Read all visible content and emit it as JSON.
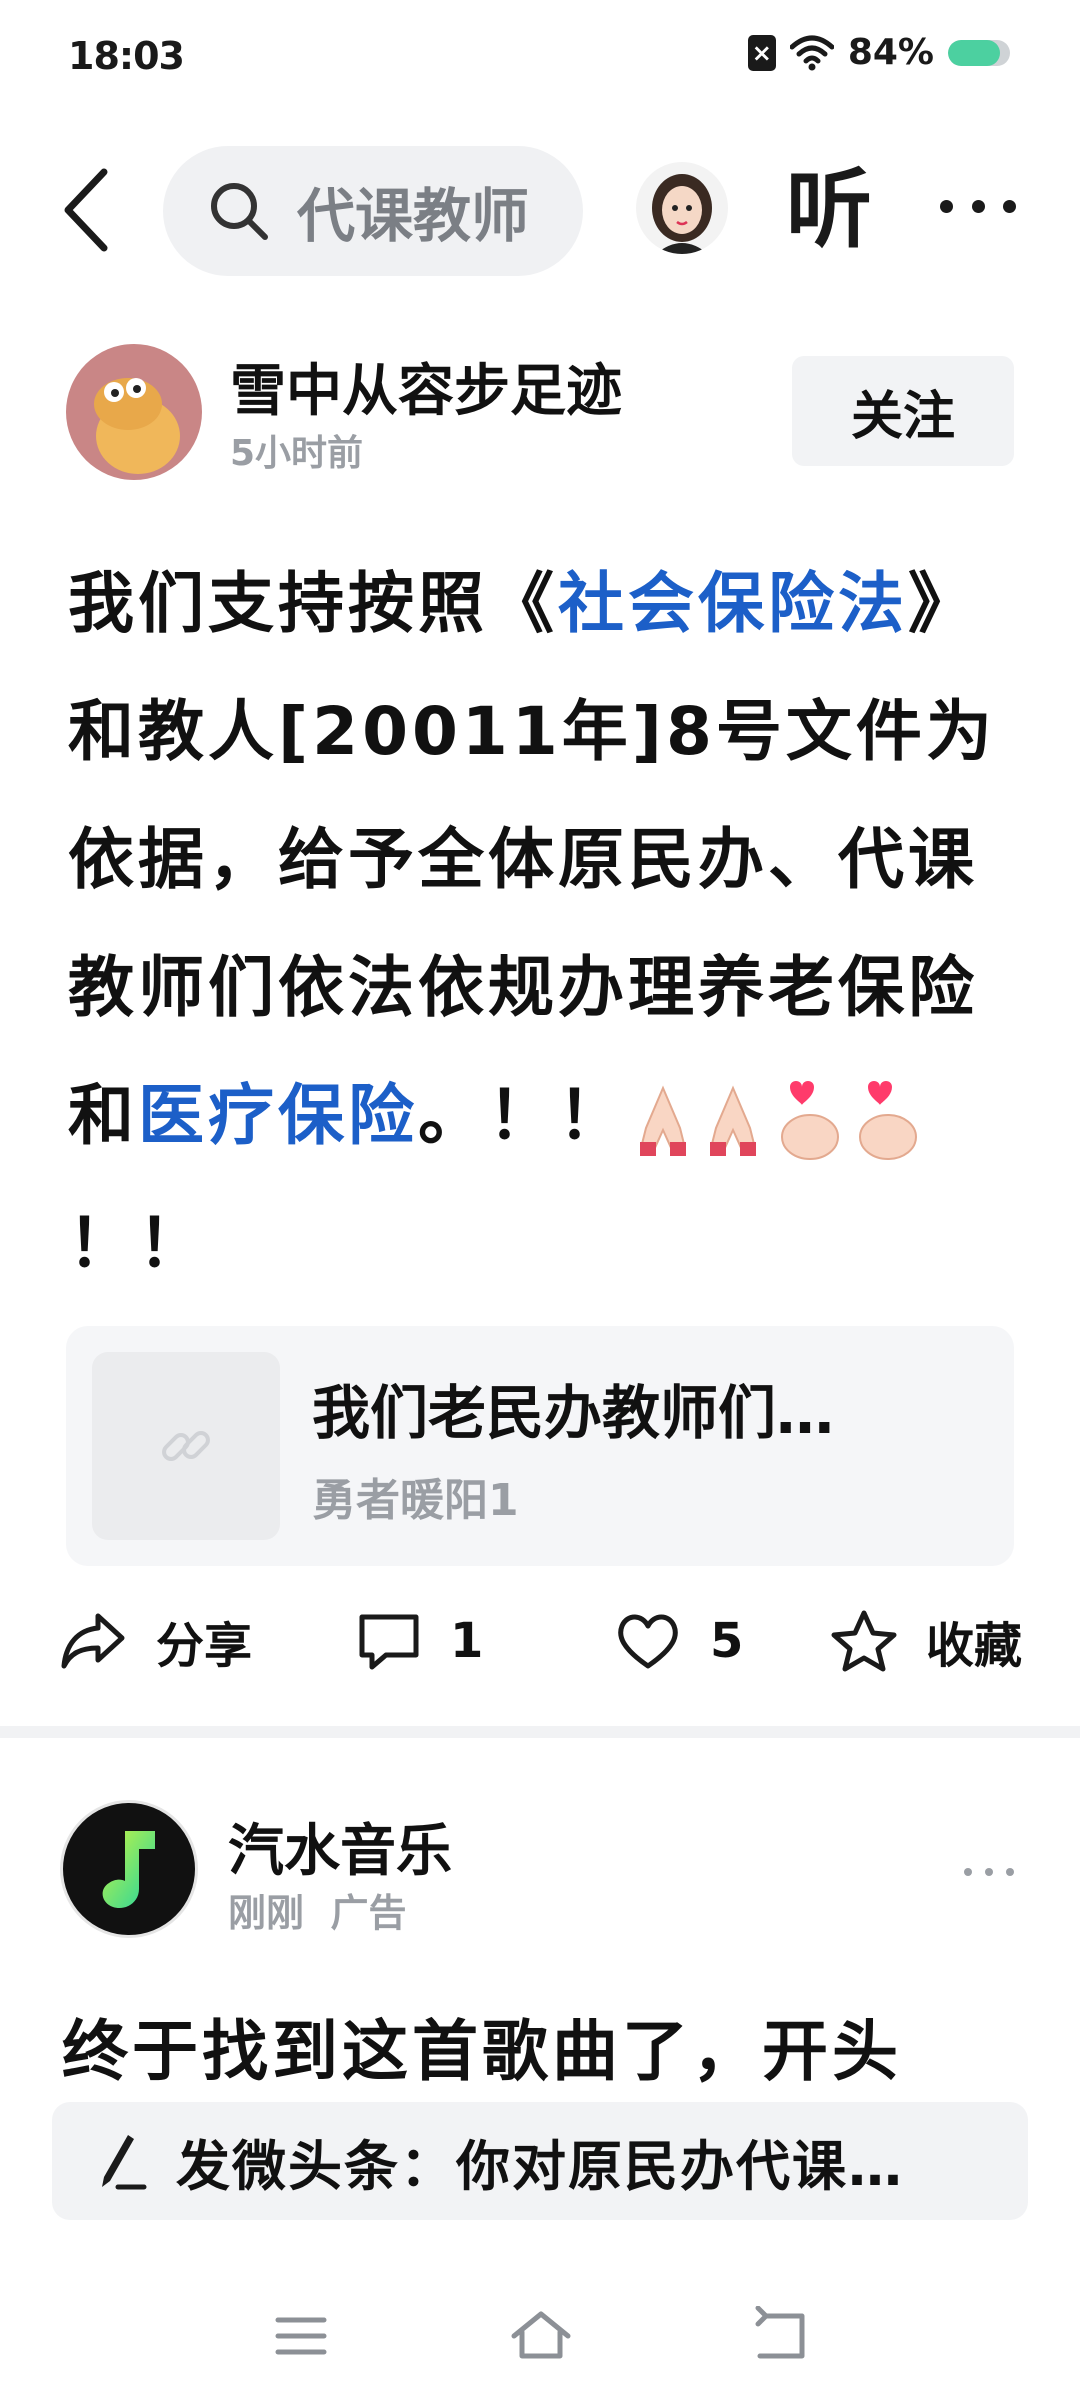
{
  "status_bar": {
    "time": "18:03",
    "battery_text": "84%",
    "battery_level": 0.84,
    "icons": [
      "sim-off-icon",
      "wifi-icon",
      "battery-icon"
    ]
  },
  "top_bar": {
    "search_text": "代课教师",
    "listen_label": "听"
  },
  "post": {
    "author": "雪中从容步足迹",
    "time": "5小时前",
    "follow_label": "关注",
    "body": {
      "p1": "我们支持按照《",
      "link1": "社会保险法",
      "p2": "》和教人[20011年]8号文件为依据，给予全体原民办、代课教师们依法依规办理养老保险和",
      "link2": "医疗保险",
      "p3": "。！！",
      "p4": "！！",
      "emojis": [
        "praying-hands",
        "praying-hands",
        "finger-heart",
        "finger-heart"
      ]
    },
    "link_card": {
      "title": "我们老民办教师们…",
      "author": "勇者暖阳1"
    },
    "actions": {
      "share": "分享",
      "comments": "1",
      "likes": "5",
      "favorite": "收藏"
    }
  },
  "ad": {
    "name": "汽水音乐",
    "time": "刚刚",
    "tag": "广告",
    "text": "终于找到这首歌曲了，开头"
  },
  "compose": {
    "text": "发微头条：你对原民办代课…"
  },
  "colors": {
    "link": "#1c5fc8",
    "battery": "#4cd0a0",
    "muted": "#9a9ea4"
  }
}
